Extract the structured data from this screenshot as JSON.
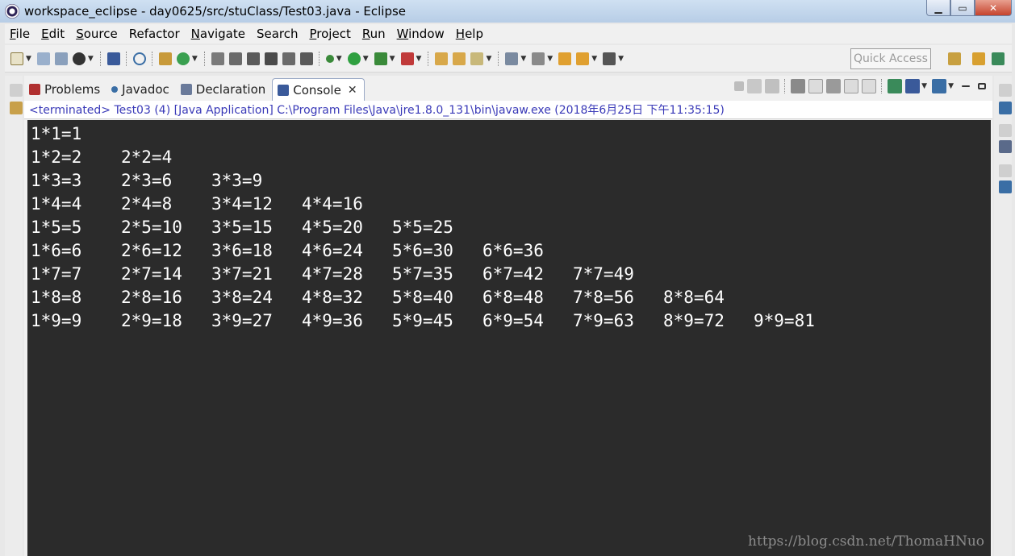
{
  "window": {
    "title": "workspace_eclipse - day0625/src/stuClass/Test03.java - Eclipse",
    "minimize_glyph": "▁",
    "maximize_glyph": "▭",
    "close_glyph": "✕"
  },
  "menu": [
    {
      "key": "F",
      "rest": "ile"
    },
    {
      "key": "E",
      "rest": "dit"
    },
    {
      "key": "S",
      "rest": "ource"
    },
    {
      "key": "",
      "rest": "Refactor"
    },
    {
      "key": "N",
      "rest": "avigate"
    },
    {
      "key": "",
      "rest": "Search"
    },
    {
      "key": "P",
      "rest": "roject"
    },
    {
      "key": "R",
      "rest": "un"
    },
    {
      "key": "W",
      "rest": "indow"
    },
    {
      "key": "H",
      "rest": "elp"
    }
  ],
  "toolbar": {
    "quick_access": "Quick Access"
  },
  "tabs": [
    {
      "label": "Problems",
      "icon": "problems-icon",
      "color": "#b03030"
    },
    {
      "label": "Javadoc",
      "icon": "javadoc-icon",
      "color": "#3a6ea5"
    },
    {
      "label": "Declaration",
      "icon": "declaration-icon",
      "color": "#6a7a9a"
    },
    {
      "label": "Console",
      "icon": "console-icon",
      "color": "#3a5a9a",
      "close": "✕"
    }
  ],
  "console": {
    "status": "<terminated> Test03 (4) [Java Application] C:\\Program Files\\Java\\jre1.8.0_131\\bin\\javaw.exe (2018年6月25日 下午11:35:15)",
    "output": [
      [
        "1*1=1"
      ],
      [
        "1*2=2",
        "2*2=4"
      ],
      [
        "1*3=3",
        "2*3=6",
        "3*3=9"
      ],
      [
        "1*4=4",
        "2*4=8",
        "3*4=12",
        "4*4=16"
      ],
      [
        "1*5=5",
        "2*5=10",
        "3*5=15",
        "4*5=20",
        "5*5=25"
      ],
      [
        "1*6=6",
        "2*6=12",
        "3*6=18",
        "4*6=24",
        "5*6=30",
        "6*6=36"
      ],
      [
        "1*7=7",
        "2*7=14",
        "3*7=21",
        "4*7=28",
        "5*7=35",
        "6*7=42",
        "7*7=49"
      ],
      [
        "1*8=8",
        "2*8=16",
        "3*8=24",
        "4*8=32",
        "5*8=40",
        "6*8=48",
        "7*8=56",
        "8*8=64"
      ],
      [
        "1*9=9",
        "2*9=18",
        "3*9=27",
        "4*9=36",
        "5*9=45",
        "6*9=54",
        "7*9=63",
        "8*9=72",
        "9*9=81"
      ]
    ],
    "background": "#2b2b2b",
    "text_color": "#ffffff"
  },
  "watermark": "https://blog.csdn.net/ThomaHNuo"
}
